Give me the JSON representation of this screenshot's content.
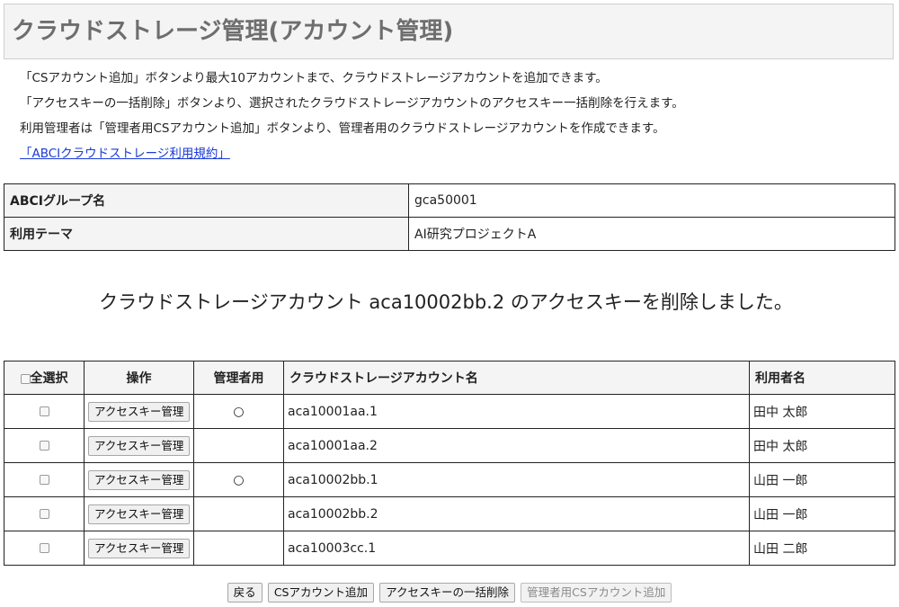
{
  "page": {
    "title": "クラウドストレージ管理(アカウント管理)"
  },
  "intro": {
    "line1": "「CSアカウント追加」ボタンより最大10アカウントまで、クラウドストレージアカウントを追加できます。",
    "line2": "「アクセスキーの一括削除」ボタンより、選択されたクラウドストレージアカウントのアクセスキー一括削除を行えます。",
    "line3": "利用管理者は「管理者用CSアカウント追加」ボタンより、管理者用のクラウドストレージアカウントを作成できます。",
    "terms_link": "「ABCIクラウドストレージ利用規約」"
  },
  "info": {
    "group_label": "ABCIグループ名",
    "group_value": "gca50001",
    "theme_label": "利用テーマ",
    "theme_value": "AI研究プロジェクトA"
  },
  "message": "クラウドストレージアカウント aca10002bb.2 のアクセスキーを削除しました。",
  "accounts": {
    "headers": {
      "select_all": "全選択",
      "operation": "操作",
      "admin": "管理者用",
      "account": "クラウドストレージアカウント名",
      "user": "利用者名"
    },
    "rows": [
      {
        "button": "アクセスキー管理",
        "admin": "○",
        "account": "aca10001aa.1",
        "user": "田中 太郎"
      },
      {
        "button": "アクセスキー管理",
        "admin": "",
        "account": "aca10001aa.2",
        "user": "田中 太郎"
      },
      {
        "button": "アクセスキー管理",
        "admin": "○",
        "account": "aca10002bb.1",
        "user": "山田 一郎"
      },
      {
        "button": "アクセスキー管理",
        "admin": "",
        "account": "aca10002bb.2",
        "user": "山田 一郎"
      },
      {
        "button": "アクセスキー管理",
        "admin": "",
        "account": "aca10003cc.1",
        "user": "山田 二郎"
      }
    ]
  },
  "footer": {
    "back": "戻る",
    "add_account": "CSアカウント追加",
    "bulk_delete": "アクセスキーの一括削除",
    "add_admin_account": "管理者用CSアカウント追加"
  }
}
